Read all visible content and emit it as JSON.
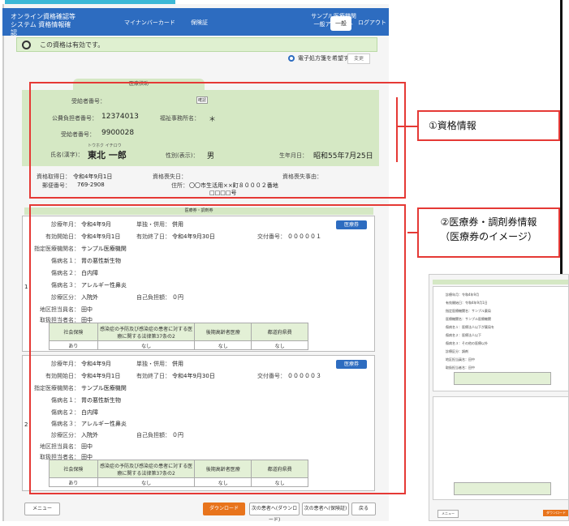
{
  "header": {
    "system_title": "オンライン資格確認等システム 資格情報確認",
    "tab_mynumber": "マイナンバーカード",
    "tab_insurance": "保険証",
    "account": "サンプル医療機関 一般アカウント",
    "mode": "一般",
    "logout": "ログアウト"
  },
  "status": {
    "message": "この資格は有効です。"
  },
  "options": {
    "radio_label": "電子処方箋を希望する",
    "change_button": "変更"
  },
  "qualification": {
    "tab_label": "医療扶助",
    "confirm_button": "確認",
    "fields": {
      "recipient_no_label": "受給者番号：",
      "payer_no_label": "公費負担者番号：",
      "payer_no": "12374013",
      "office_label": "福祉事務所名：",
      "office": "＊",
      "recipient_no2_label": "受給者番号：",
      "recipient_no2": "9900028",
      "kana": "トウホク イチロウ",
      "name_label": "氏名(漢字)：",
      "name": "東北 一郎",
      "gender_label": "性別(表示)：",
      "gender": "男",
      "dob_label": "生年月日：",
      "dob": "昭和55年7月25日"
    }
  },
  "sub": {
    "start_label": "資格取得日：",
    "start": "令和4年9月1日",
    "lost_label": "資格喪失日：",
    "lost": "",
    "reason_label": "資格喪失事由：",
    "reason": "",
    "postal_label": "郵便番号：",
    "postal": "769-2908",
    "address_label": "住所：",
    "address": "〇〇市生活用××町８０００２番地",
    "address2": "□□□□号"
  },
  "medical_section": {
    "title": "医療券・調剤券"
  },
  "records": [
    {
      "index": "1",
      "month_label": "診療年月：",
      "month": "令和4年9月",
      "type_label": "単独・併用：",
      "type": "併用",
      "valid_from_label": "有効開始日：",
      "valid_from": "令和4年9月1日",
      "valid_to_label": "有効終了日：",
      "valid_to": "令和4年9月30日",
      "issue_label": "交付番号：",
      "issue": "０００００１",
      "button": "医療券",
      "inst_label": "指定医療機関名：",
      "inst": "サンプル医療機関",
      "d1_label": "傷病名１：",
      "d1": "胃の悪性新生物",
      "d2_label": "傷病名２：",
      "d2": "白内障",
      "d3_label": "傷病名３：",
      "d3": "アレルギー性鼻炎",
      "cat_label": "診療区分：",
      "cat": "入院外",
      "copay_label": "自己負担額：",
      "copay": "０円",
      "area_label": "地区担当員名：",
      "area": "田中",
      "handler_label": "取扱担当者名：",
      "handler": "田中",
      "table_headers": [
        "社会保険",
        "感染症の予防及び感染症の患者に対する医療に関する法律第37条の2",
        "後期高齢者医療",
        "都道府県費"
      ],
      "table_values": [
        "あり",
        "なし",
        "なし",
        "なし"
      ]
    },
    {
      "index": "2",
      "month_label": "診療年月：",
      "month": "令和4年9月",
      "type_label": "単独・併用：",
      "type": "併用",
      "valid_from_label": "有効開始日：",
      "valid_from": "令和4年9月1日",
      "valid_to_label": "有効終了日：",
      "valid_to": "令和4年9月30日",
      "issue_label": "交付番号：",
      "issue": "０００００３",
      "button": "医療券",
      "inst_label": "指定医療機関名：",
      "inst": "サンプル医療機関",
      "d1_label": "傷病名１：",
      "d1": "胃の悪性新生物",
      "d2_label": "傷病名２：",
      "d2": "白内障",
      "d3_label": "傷病名３：",
      "d3": "アレルギー性鼻炎",
      "cat_label": "診療区分：",
      "cat": "入院外",
      "copay_label": "自己負担額：",
      "copay": "０円",
      "area_label": "地区担当員名：",
      "area": "田中",
      "handler_label": "取扱担当者名：",
      "handler": "田中",
      "table_headers": [
        "社会保険",
        "感染症の予防及び感染症の患者に対する医療に関する法律第37条の2",
        "後期高齢者医療",
        "都道府県費"
      ],
      "table_values": [
        "あり",
        "なし",
        "なし",
        "なし"
      ]
    }
  ],
  "footer": {
    "menu": "メニュー",
    "download": "ダウンロード",
    "prev": "次の患者へ(ダウンロード)",
    "next": "次の患者へ(保険証)",
    "back": "戻る"
  },
  "annotations": {
    "a1": "①資格情報",
    "a2_line1": "②医療券・調剤券情報",
    "a2_line2": "（医療券のイメージ）"
  },
  "thumbnail": {
    "labels": [
      "診療年月：令和4年9月",
      "有効開始日：令和4年9月1日",
      "指定医療機関名：サンプル薬局",
      "医療機関名：サンプル医療機関",
      "傷病名１：医療法人以下が薬局を",
      "傷病名２：医療法人以下",
      "傷病名３：その他の医療以外",
      "診療区分：調剤",
      "地区担当員名：田中",
      "取扱担当者名：田中"
    ],
    "menu": "メニュー",
    "download": "ダウンロード"
  },
  "colors": {
    "header": "#2d6cc0",
    "panel": "#d5e8c4",
    "accent": "#e8741c",
    "annotation": "#e53935"
  }
}
